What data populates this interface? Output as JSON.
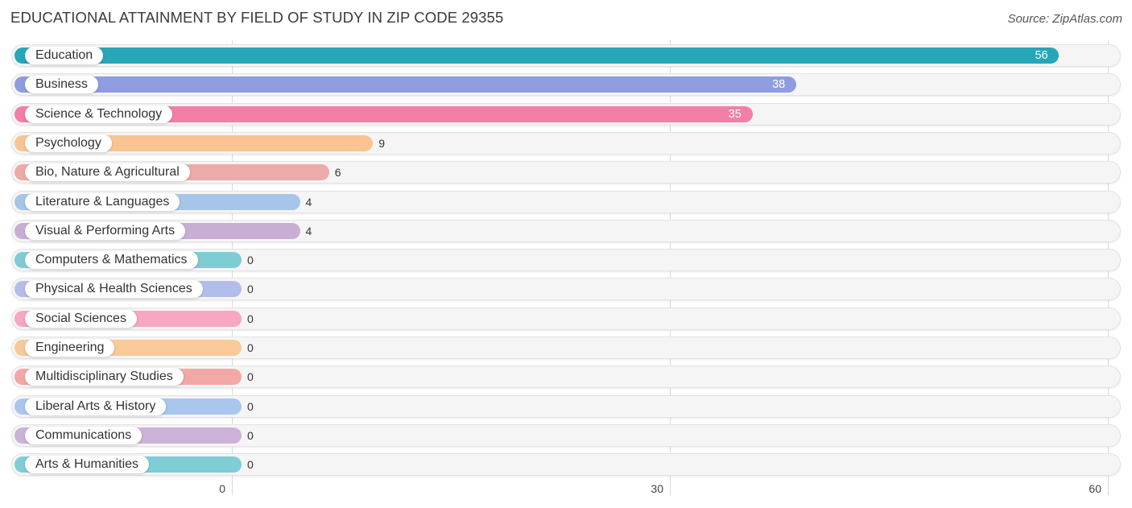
{
  "header": {
    "title": "EDUCATIONAL ATTAINMENT BY FIELD OF STUDY IN ZIP CODE 29355",
    "source": "Source: ZipAtlas.com"
  },
  "chart_data": {
    "type": "bar",
    "orientation": "horizontal",
    "title": "EDUCATIONAL ATTAINMENT BY FIELD OF STUDY IN ZIP CODE 29355",
    "xlabel": "",
    "ylabel": "",
    "xlim": [
      0,
      60
    ],
    "x_ticks": [
      "0",
      "30",
      "60"
    ],
    "grid": true,
    "categories": [
      "Education",
      "Business",
      "Science & Technology",
      "Psychology",
      "Bio, Nature & Agricultural",
      "Literature & Languages",
      "Visual & Performing Arts",
      "Computers & Mathematics",
      "Physical & Health Sciences",
      "Social Sciences",
      "Engineering",
      "Multidisciplinary Studies",
      "Liberal Arts & History",
      "Communications",
      "Arts & Humanities"
    ],
    "values": [
      56,
      38,
      35,
      9,
      6,
      4,
      4,
      0,
      0,
      0,
      0,
      0,
      0,
      0,
      0
    ],
    "colors": [
      "#27a6b8",
      "#8e9de0",
      "#f47fa4",
      "#f9c490",
      "#eeaaa8",
      "#a6c5ea",
      "#c9aed4",
      "#7fcdd4",
      "#b3bdea",
      "#f7a6c3",
      "#f9c99a",
      "#f2a8a6",
      "#a9c6ee",
      "#cdb2d8",
      "#7fcdd6"
    ]
  }
}
